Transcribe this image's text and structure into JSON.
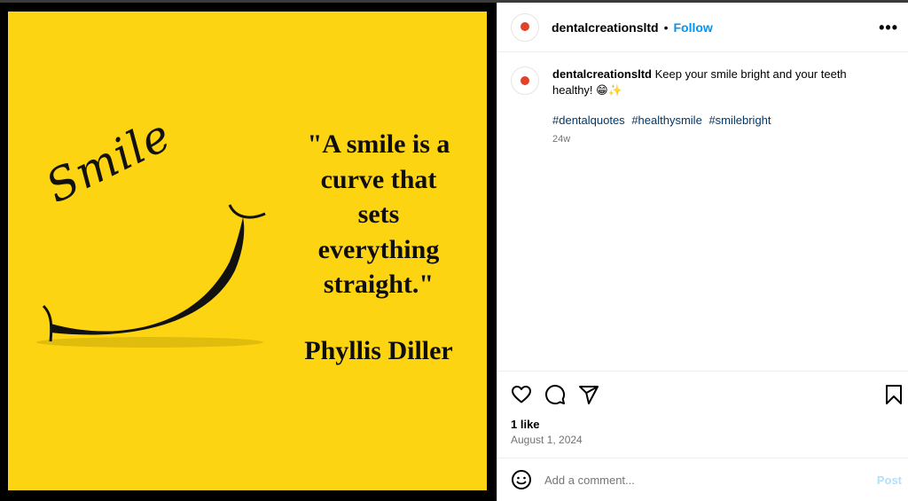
{
  "poster": {
    "script_word": "Smile",
    "quote_lines": [
      "\"A smile is a",
      "curve that",
      "sets",
      "everything",
      "straight.\""
    ],
    "author": "Phyllis Diller",
    "background_color": "#fdd411"
  },
  "header": {
    "username": "dentalcreationsltd",
    "separator": "•",
    "follow_label": "Follow",
    "more_label": "•••"
  },
  "caption": {
    "username": "dentalcreationsltd",
    "text": "Keep your smile bright and your teeth healthy! 😁✨",
    "hashtags": [
      "#dentalquotes",
      "#healthysmile",
      "#smilebright"
    ],
    "time_ago": "24w"
  },
  "engagement": {
    "likes": "1 like",
    "date": "August 1, 2024"
  },
  "comment_box": {
    "placeholder": "Add a comment...",
    "post_label": "Post"
  },
  "icons": {
    "like": "heart-icon",
    "comment": "comment-icon",
    "share": "send-icon",
    "save": "bookmark-icon",
    "emoji": "emoji-icon",
    "more": "more-options-icon"
  },
  "colors": {
    "link_blue": "#0095f6",
    "hashtag": "#00376b",
    "post_disabled": "#b2dffc"
  }
}
